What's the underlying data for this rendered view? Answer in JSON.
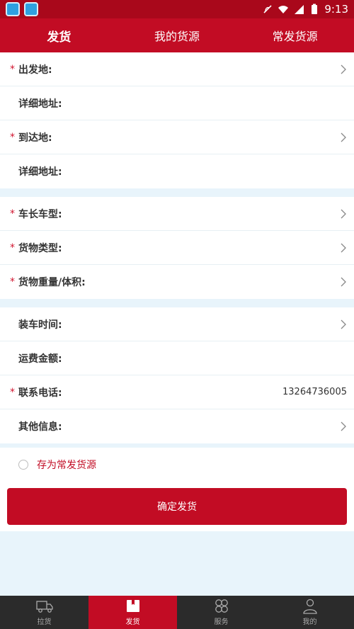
{
  "status_bar": {
    "time": "9:13"
  },
  "top_nav": {
    "tabs": [
      {
        "label": "发货",
        "active": true
      },
      {
        "label": "我的货源",
        "active": false
      },
      {
        "label": "常发货源",
        "active": false
      }
    ]
  },
  "form": {
    "groups": [
      [
        {
          "label": "出发地:",
          "required": true,
          "chevron": true,
          "value": ""
        },
        {
          "label": "详细地址:",
          "required": false,
          "chevron": false,
          "value": ""
        },
        {
          "label": "到达地:",
          "required": true,
          "chevron": true,
          "value": ""
        },
        {
          "label": "详细地址:",
          "required": false,
          "chevron": false,
          "value": ""
        }
      ],
      [
        {
          "label": "车长车型:",
          "required": true,
          "chevron": true,
          "value": ""
        },
        {
          "label": "货物类型:",
          "required": true,
          "chevron": true,
          "value": ""
        },
        {
          "label": "货物重量/体积:",
          "required": true,
          "chevron": true,
          "value": ""
        }
      ],
      [
        {
          "label": "装车时间:",
          "required": false,
          "chevron": true,
          "value": ""
        },
        {
          "label": "运费金额:",
          "required": false,
          "chevron": false,
          "value": ""
        },
        {
          "label": "联系电话:",
          "required": true,
          "chevron": false,
          "value": "13264736005"
        },
        {
          "label": "其他信息:",
          "required": false,
          "chevron": true,
          "value": ""
        }
      ]
    ],
    "required_mark": "*"
  },
  "save_option": {
    "label": "存为常发货源",
    "checked": false
  },
  "submit": {
    "label": "确定发货"
  },
  "bottom_nav": {
    "items": [
      {
        "label": "拉货",
        "icon": "truck-icon",
        "active": false
      },
      {
        "label": "发货",
        "icon": "package-icon",
        "active": true
      },
      {
        "label": "服务",
        "icon": "clover-icon",
        "active": false
      },
      {
        "label": "我的",
        "icon": "person-icon",
        "active": false
      }
    ]
  },
  "colors": {
    "brand": "#c20c24",
    "status_bar": "#a9081b",
    "background": "#e8f4fb"
  }
}
